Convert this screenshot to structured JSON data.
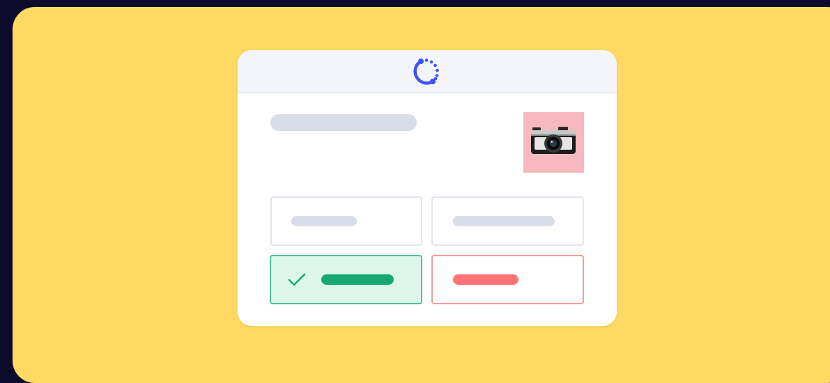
{
  "colors": {
    "background": "#ffd963",
    "card": "#ffffff",
    "header": "#f4f5fb",
    "logo": "#3f52f2",
    "placeholder": "#d9dde8",
    "thumbnail": "#f7b9bd",
    "correct": "#16a874",
    "correct_fill": "#ddf6ec",
    "wrong": "#ff7275"
  },
  "icons": {
    "logo": "circular-dots-logo-icon",
    "thumbnail": "camera-icon",
    "correct": "checkmark-icon"
  },
  "options": [
    {
      "state": "neutral"
    },
    {
      "state": "neutral"
    },
    {
      "state": "correct"
    },
    {
      "state": "wrong"
    }
  ]
}
